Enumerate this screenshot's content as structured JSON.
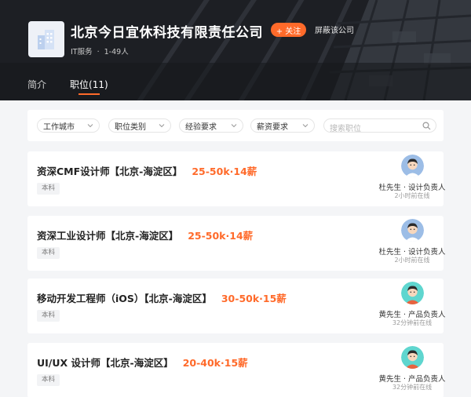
{
  "company": {
    "name": "北京今日宜休科技有限责任公司",
    "follow_label": "+ 关注",
    "block_label": "屏蔽该公司",
    "industry": "IT服务",
    "separator": "·",
    "size": "1-49人",
    "logo_icon": "building-icon"
  },
  "tabs": [
    {
      "label": "简介",
      "active": false
    },
    {
      "label": "职位(11)",
      "active": true
    }
  ],
  "filters": {
    "city": "工作城市",
    "category": "职位类别",
    "experience": "经验要求",
    "salary": "薪资要求",
    "search_placeholder": "搜索职位"
  },
  "jobs": [
    {
      "title": "资深CMF设计师【北京-海淀区】",
      "salary": "25-50k·14薪",
      "tag": "本科",
      "recruiter": "杜先生 · 设计负责人",
      "online": "2小时前在线",
      "avatar": "recruiter-avatar-icon"
    },
    {
      "title": "资深工业设计师【北京-海淀区】",
      "salary": "25-50k·14薪",
      "tag": "本科",
      "recruiter": "杜先生 · 设计负责人",
      "online": "2小时前在线",
      "avatar": "recruiter-avatar-icon"
    },
    {
      "title": "移动开发工程师（iOS）【北京-海淀区】",
      "salary": "30-50k·15薪",
      "tag": "本科",
      "recruiter": "黄先生 · 产品负责人",
      "online": "32分钟前在线",
      "avatar": "recruiter-avatar-icon"
    },
    {
      "title": "UI/UX 设计师【北京-海淀区】",
      "salary": "20-40k·15薪",
      "tag": "本科",
      "recruiter": "黄先生 · 产品负责人",
      "online": "32分钟前在线",
      "avatar": "recruiter-avatar-icon"
    }
  ],
  "colors": {
    "accent": "#ff6a2a",
    "header_bg": "#1b1d22"
  }
}
